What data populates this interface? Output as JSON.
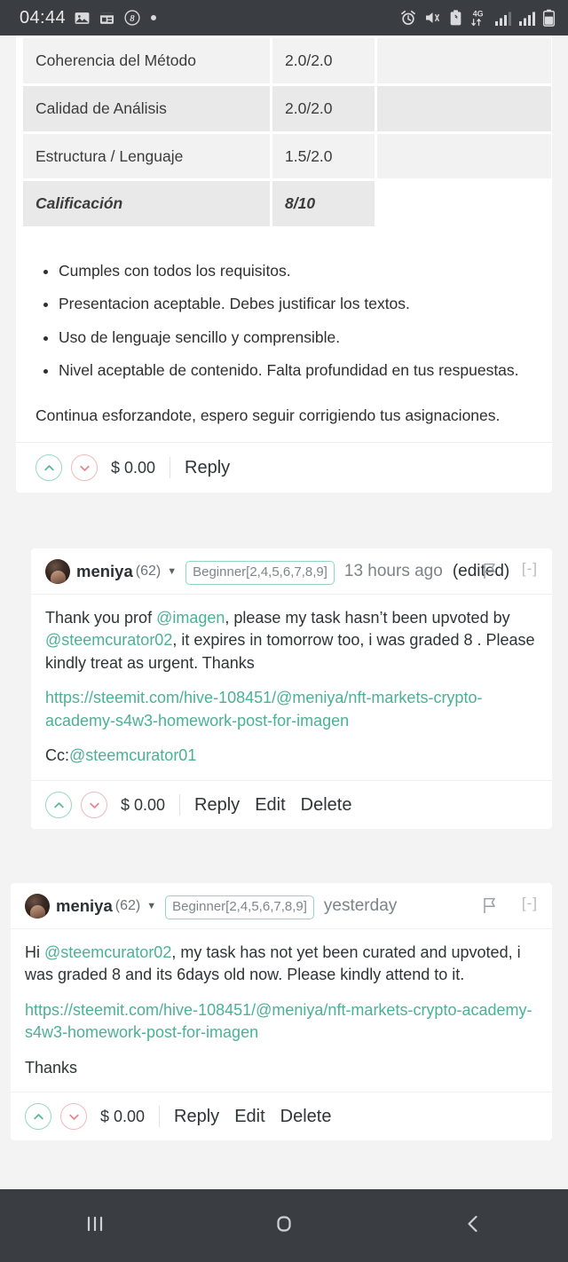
{
  "statusbar": {
    "clock": "04:44",
    "left_icons": [
      "image-icon",
      "calendar-icon",
      "circled-b-icon",
      "dot-icon"
    ],
    "right_icons": [
      "alarm-icon",
      "mute-vibrate-icon",
      "battery-saver-icon",
      "network-4g-icon",
      "signal-1-icon",
      "signal-2-icon",
      "battery-icon"
    ],
    "network_label": "4G"
  },
  "grading_table": {
    "rows": [
      {
        "criterion": "Coherencia del Método",
        "score": "2.0/2.0",
        "note": ""
      },
      {
        "criterion": "Calidad de Análisis",
        "score": "2.0/2.0",
        "note": ""
      },
      {
        "criterion": "Estructura / Lenguaje",
        "score": "1.5/2.0",
        "note": ""
      },
      {
        "criterion": "Calificación",
        "score": "8/10",
        "note": ""
      }
    ]
  },
  "feedback": {
    "bullets": [
      "Cumples con todos los requisitos.",
      "Presentacion aceptable. Debes justificar los textos.",
      "Uso de lenguaje sencillo y comprensible.",
      "Nivel aceptable de contenido. Falta profundidad en tus respuestas."
    ],
    "closing": "Continua esforzandote, espero seguir corrigiendo tus asignaciones."
  },
  "post_actions": {
    "payout": "$ 0.00",
    "reply_label": "Reply",
    "upvote_icon": "chevron-up-icon",
    "downvote_icon": "chevron-down-icon"
  },
  "comments": [
    {
      "author": "meniya",
      "reputation": "(62)",
      "badge": "Beginner[2,4,5,6,7,8,9]",
      "timestamp": "13 hours ago",
      "edited": "(edited)",
      "collapse": "[-]",
      "body_line1_a": "Thank you prof ",
      "body_line1_mention": "@imagen",
      "body_line1_b": ", please my task hasn’t been upvoted by ",
      "body_line1_mention2": "@steemcurator02",
      "body_line1_c": ", it expires in tomorrow too, i was graded 8 . Please kindly treat as urgent. Thanks",
      "link": "https://steemit.com/hive-108451/@meniya/nft-markets-crypto-academy-s4w3-homework-post-for-imagen",
      "cc_prefix": "Cc:",
      "cc_mention": "@steemcurator01",
      "payout": "$ 0.00",
      "actions": [
        "Reply",
        "Edit",
        "Delete"
      ]
    },
    {
      "author": "meniya",
      "reputation": "(62)",
      "badge": "Beginner[2,4,5,6,7,8,9]",
      "timestamp": "yesterday",
      "edited": "",
      "collapse": "[-]",
      "body_line1_a": "Hi ",
      "body_line1_mention": "@steemcurator02",
      "body_line1_b": ", my task has not yet been curated and upvoted, i was graded 8 and its 6days old now. Please kindly attend to it.",
      "link": "https://steemit.com/hive-108451/@meniya/nft-markets-crypto-academy-s4w3-homework-post-for-imagen",
      "thanks": "Thanks",
      "payout": "$ 0.00",
      "actions": [
        "Reply",
        "Edit",
        "Delete"
      ]
    }
  ],
  "navbar": {
    "recents": "recents-icon",
    "home": "home-icon",
    "back": "back-icon"
  },
  "colors": {
    "accent_teal": "#4ab294",
    "upvote": "#5bb99a",
    "downvote": "#e08a92",
    "status_bg": "#3a3d42",
    "page_bg": "#f3f3f3"
  }
}
